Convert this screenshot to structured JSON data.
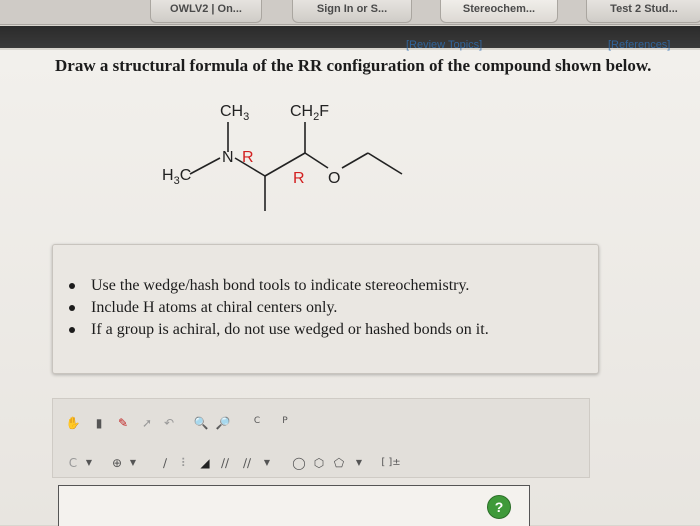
{
  "tabs": [
    {
      "label": "OWLV2 | On..."
    },
    {
      "label": "Sign In or S..."
    },
    {
      "label": "Stereochem..."
    },
    {
      "label": "Test 2 Stud..."
    }
  ],
  "links": {
    "review_topics": "[Review Topics]",
    "references": "[References]"
  },
  "question": {
    "prefix": "Draw a structural formula of the ",
    "emphasis": "RR",
    "suffix": " configuration of the compound shown below."
  },
  "molecule": {
    "labels": {
      "ch3_top": "CH",
      "ch3_sub": "3",
      "ch2f_main": "CH",
      "ch2f_sub": "2",
      "ch2f_end": "F",
      "h3c_main": "H",
      "h3c_sub": "3",
      "h3c_end": "C",
      "n": "N",
      "o": "O",
      "r1": "R",
      "r2": "R"
    },
    "colors": {
      "stereo_label": "#d22020",
      "bonds": "#222222"
    }
  },
  "instructions": [
    "Use the wedge/hash bond tools to indicate stereochemistry.",
    "Include H atoms at chiral centers only.",
    "If a group is achiral, do not use wedged or hashed bonds on it."
  ],
  "toolbar": {
    "row1_icons": [
      "hand-icon",
      "eraser-icon",
      "pencil-icon",
      "lasso-icon",
      "undo-icon",
      "zoom-in-icon",
      "zoom-out-icon",
      "copy-icon",
      "paste-icon"
    ],
    "copy_label": "C",
    "paste_label": "P",
    "atom_select": "C",
    "bracket_label": "[ ]±"
  },
  "help": {
    "label": "?",
    "color": "#3f9a3a"
  }
}
